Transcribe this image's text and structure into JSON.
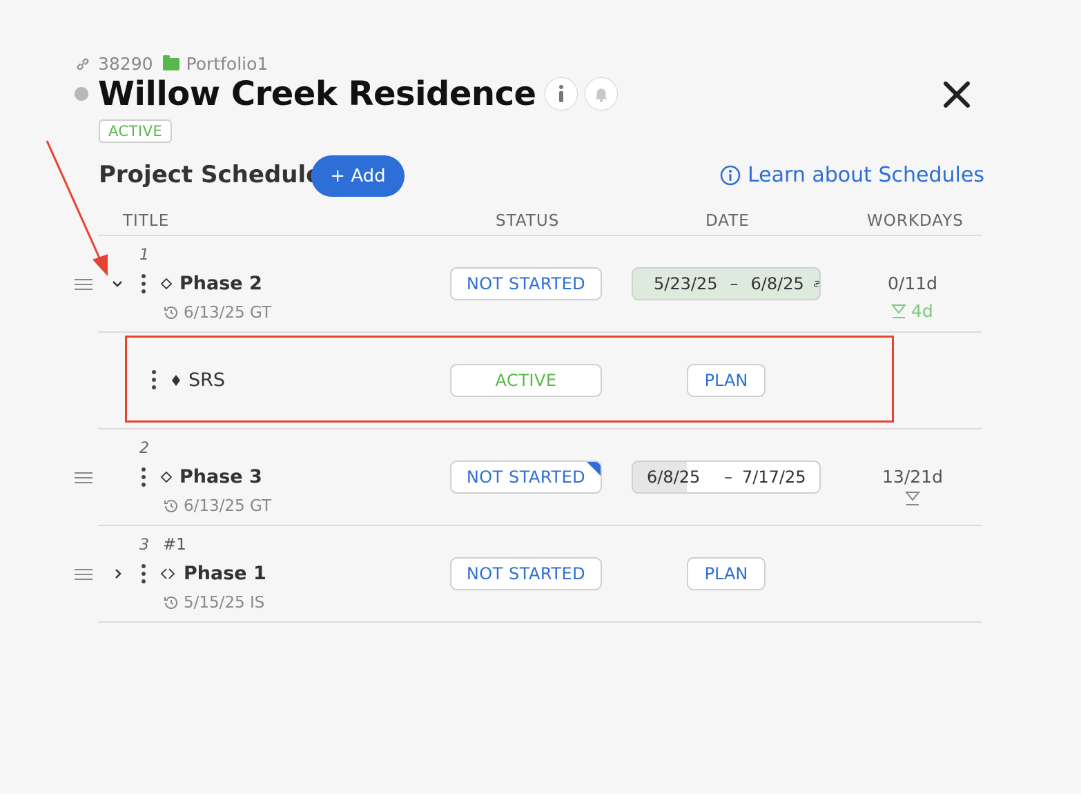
{
  "header": {
    "project_id": "38290",
    "portfolio": "Portfolio1",
    "title": "Willow Creek Residence",
    "status": "ACTIVE",
    "info_icon": "info-icon",
    "bell_icon": "bell-icon"
  },
  "schedule": {
    "title": "Project Schedule",
    "add_label": "+ Add",
    "learn_link": "Learn about Schedules",
    "columns": [
      "TITLE",
      "STATUS",
      "DATE",
      "WORKDAYS"
    ],
    "rows": [
      {
        "num": "1",
        "title": "Phase 2",
        "sub": "6/13/25 GT",
        "status": "NOT STARTED",
        "date_start": "5/23/25",
        "date_end": "6/8/25",
        "date_sep": "–",
        "workdays": "0/11d",
        "workdays_extra": "4d",
        "expanded": true
      },
      {
        "title": "SRS",
        "status": "ACTIVE",
        "date": "PLAN"
      },
      {
        "num": "2",
        "title": "Phase 3",
        "sub": "6/13/25 GT",
        "status": "NOT STARTED",
        "date_start": "6/8/25",
        "date_end": "7/17/25",
        "date_sep": "–",
        "workdays": "13/21d"
      },
      {
        "num": "3",
        "tag": "#1",
        "title": "Phase 1",
        "sub": "5/15/25 IS",
        "status": "NOT STARTED",
        "date": "PLAN"
      }
    ]
  },
  "colors": {
    "accent": "#2d6fd6",
    "green": "#56b848",
    "annotation": "#e64431"
  }
}
